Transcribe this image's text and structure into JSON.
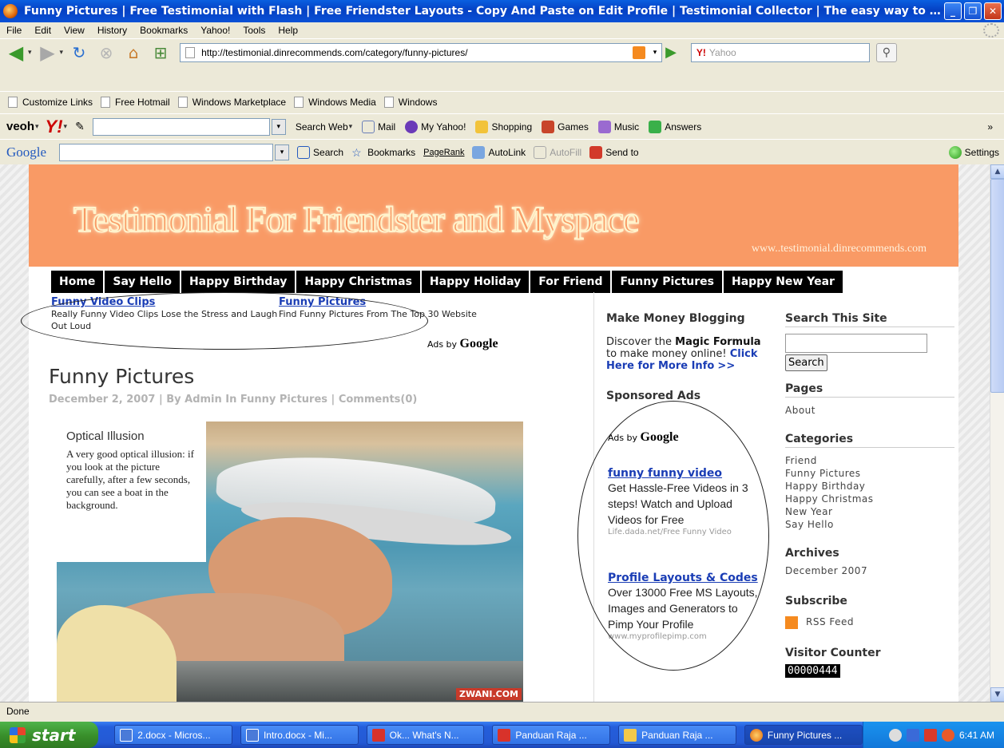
{
  "window": {
    "title": "Funny Pictures | Free Testimonial with Flash | Free Friendster Layouts - Copy And Paste on Edit Profile | Testimonial Collector | The easy way to get..."
  },
  "menubar": [
    "File",
    "Edit",
    "View",
    "History",
    "Bookmarks",
    "Yahoo!",
    "Tools",
    "Help"
  ],
  "navbar": {
    "url": "http://testimonial.dinrecommends.com/category/funny-pictures/",
    "search_placeholder": "Yahoo",
    "search_engine_label": "Y!"
  },
  "bookmarks": [
    "Customize Links",
    "Free Hotmail",
    "Windows Marketplace",
    "Windows Media",
    "Windows"
  ],
  "yahoo_toolbar": {
    "brand": "veoh",
    "search_web": "Search Web",
    "items": [
      "Mail",
      "My Yahoo!",
      "Shopping",
      "Games",
      "Music",
      "Answers"
    ],
    "overflow": "»"
  },
  "google_toolbar": {
    "logo": "Google",
    "items": [
      "Search",
      "Bookmarks",
      "PageRank",
      "AutoLink",
      "AutoFill",
      "Send to"
    ],
    "settings": "Settings"
  },
  "site": {
    "banner_title": "Testimonial For Friendster and Myspace",
    "banner_url": "www..testimonial.dinrecommends.com",
    "nav": [
      "Home",
      "Say Hello",
      "Happy Birthday",
      "Happy Christmas",
      "Happy Holiday",
      "For Friend",
      "Funny Pictures",
      "Happy New Year"
    ],
    "top_ads": [
      {
        "title": "Funny Video Clips",
        "desc": "Really Funny Video Clips Lose the Stress and Laugh Out Loud"
      },
      {
        "title": "Funny Pictures",
        "desc": "Find Funny Pictures From The Top 30 Website"
      }
    ],
    "ads_by": "Ads by",
    "ads_by_brand": "Google",
    "post": {
      "title": "Funny Pictures",
      "meta": "December 2, 2007 | By Admin In Funny Pictures | Comments(0)",
      "caption_title": "Optical Illusion",
      "caption_body": "A very good optical illusion: if you look at the picture carefully, after a few seconds, you can see a boat in the background.",
      "watermark": "ZWANI.COM"
    },
    "middle": {
      "money_heading": "Make Money Blogging",
      "money_text_1": "Discover the",
      "money_bold": "Magic Formula",
      "money_text_2": "to make money online!",
      "money_link": "Click Here for More Info",
      "money_arrow": ">>",
      "sponsored_heading": "Sponsored Ads",
      "ads": [
        {
          "title": "funny funny video",
          "desc": "Get Hassle-Free Videos in 3 steps! Watch and Upload Videos for Free",
          "url": "Life.dada.net/Free Funny Video"
        },
        {
          "title": "Profile Layouts & Codes",
          "desc": "Over 13000 Free MS Layouts, Images and Generators to Pimp Your Profile",
          "url": "www.myprofilepimp.com"
        }
      ]
    },
    "right": {
      "search_heading": "Search This Site",
      "search_button": "Search",
      "pages_heading": "Pages",
      "pages": [
        "About"
      ],
      "categories_heading": "Categories",
      "categories": [
        "Friend",
        "Funny Pictures",
        "Happy Birthday",
        "Happy Christmas",
        "New Year",
        "Say Hello"
      ],
      "archives_heading": "Archives",
      "archives": [
        "December 2007"
      ],
      "subscribe_heading": "Subscribe",
      "rss": "RSS Feed",
      "counter_heading": "Visitor Counter",
      "counter": "00000444"
    }
  },
  "status": "Done",
  "taskbar": {
    "start": "start",
    "tasks": [
      "2.docx - Micros...",
      "Intro.docx - Mi...",
      "Ok... What's N...",
      "Panduan Raja ...",
      "Panduan Raja ...",
      "Funny Pictures ..."
    ],
    "clock": "6:41 AM"
  }
}
